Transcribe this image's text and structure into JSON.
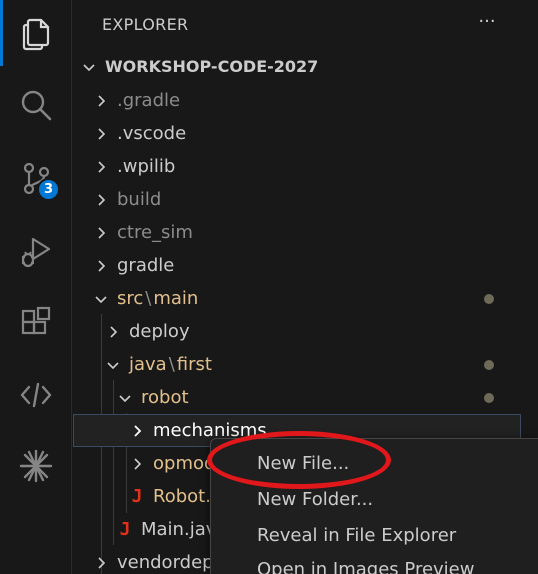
{
  "activity_bar": {
    "items": [
      {
        "name": "explorer",
        "icon": "files-icon",
        "active": true
      },
      {
        "name": "search",
        "icon": "search-icon"
      },
      {
        "name": "source-control",
        "icon": "source-control-icon",
        "badge": "3"
      },
      {
        "name": "run-debug",
        "icon": "run-debug-icon"
      },
      {
        "name": "extensions",
        "icon": "extensions-icon"
      },
      {
        "name": "remote",
        "icon": "remote-explorer-icon"
      },
      {
        "name": "snowflake",
        "icon": "snowflake-icon"
      }
    ],
    "accent_color": "#0078d4"
  },
  "sidebar": {
    "title": "EXPLORER",
    "more_label": "···",
    "workspace": "WORKSHOP-CODE-2027",
    "tree": [
      {
        "label": ".gradle"
      },
      {
        "label": ".vscode"
      },
      {
        "label": ".wpilib"
      },
      {
        "label": "build"
      },
      {
        "label": "ctre_sim"
      },
      {
        "label": "gradle"
      },
      {
        "label": "src",
        "label2": "main",
        "sep": "\\"
      },
      {
        "label": "deploy"
      },
      {
        "label": "java",
        "label2": "first",
        "sep": "\\"
      },
      {
        "label": "robot"
      },
      {
        "label": "mechanisms"
      },
      {
        "label": "opmodes"
      },
      {
        "label": "Robot.java"
      },
      {
        "label": "Main.java"
      },
      {
        "label": "vendordeps"
      }
    ]
  },
  "context_menu": {
    "items": [
      {
        "label": "New File..."
      },
      {
        "label": "New Folder..."
      },
      {
        "label": "Reveal in File Explorer"
      },
      {
        "label": "Open in Images Preview"
      }
    ],
    "highlight_color": "#e0171b"
  }
}
